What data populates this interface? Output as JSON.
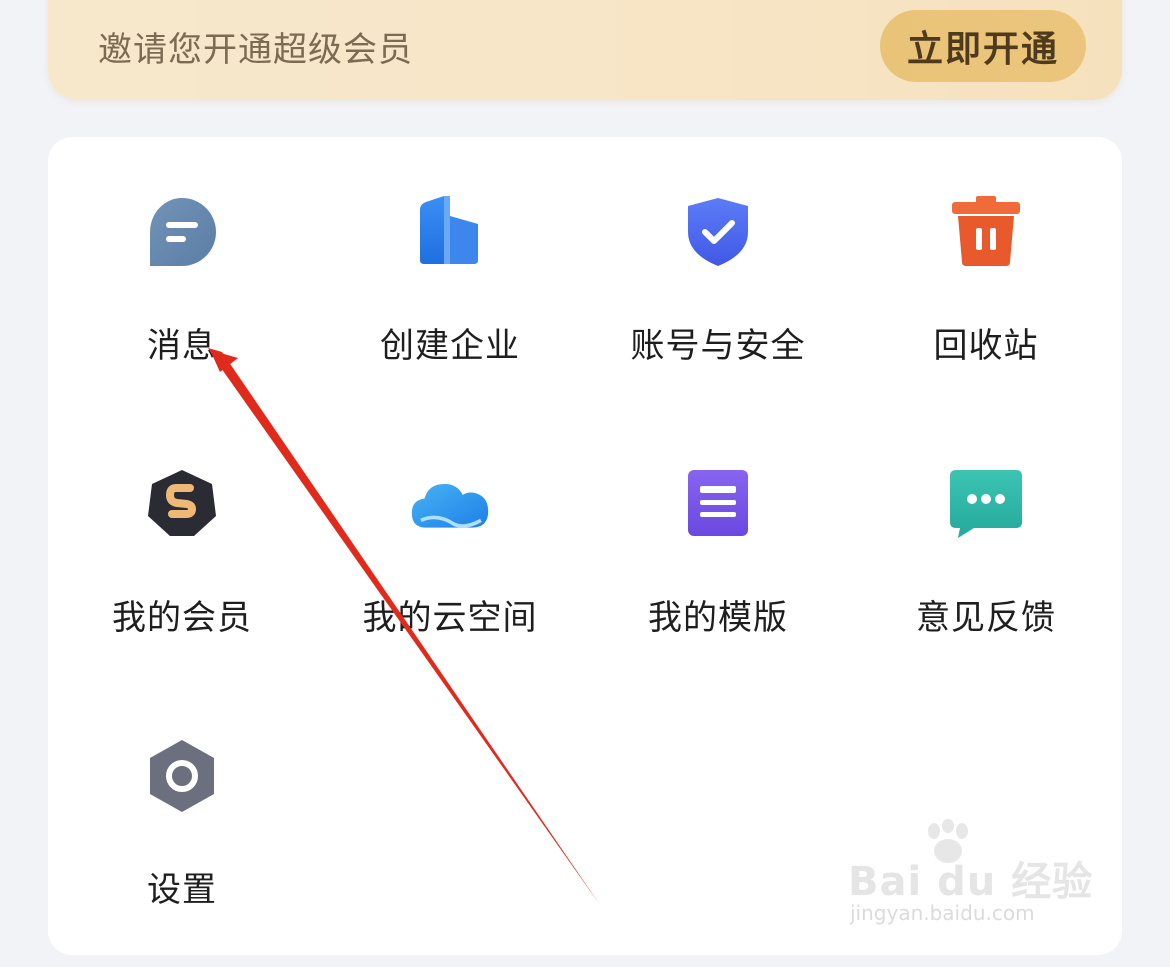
{
  "vip_banner": {
    "text": "邀请您开通超级会员",
    "button_label": "立即开通"
  },
  "menu": {
    "items": [
      {
        "label": "消息",
        "icon": "message-icon"
      },
      {
        "label": "创建企业",
        "icon": "building-icon"
      },
      {
        "label": "账号与安全",
        "icon": "shield-check-icon"
      },
      {
        "label": "回收站",
        "icon": "trash-icon"
      },
      {
        "label": "我的会员",
        "icon": "vip-badge-icon"
      },
      {
        "label": "我的云空间",
        "icon": "cloud-icon"
      },
      {
        "label": "我的模版",
        "icon": "template-icon"
      },
      {
        "label": "意见反馈",
        "icon": "feedback-icon"
      },
      {
        "label": "设置",
        "icon": "settings-icon"
      }
    ]
  },
  "watermark": {
    "text": "Bai du 经验",
    "sub": "jingyan.baidu.com"
  },
  "colors": {
    "banner_bg": "#f7e6c8",
    "button_bg": "#eac57b",
    "annotation_arrow": "#e02a1c"
  }
}
